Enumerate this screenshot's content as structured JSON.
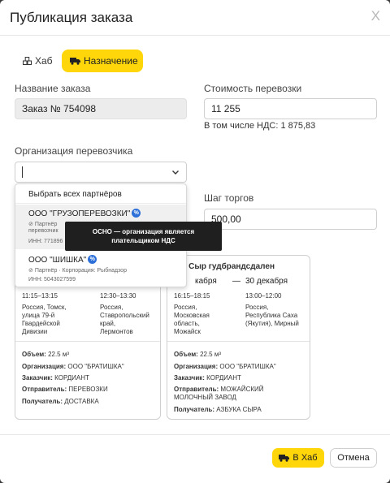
{
  "header": {
    "title": "Публикация заказа",
    "close": "X"
  },
  "tabs": [
    {
      "label": "Хаб",
      "icon": "cubes-icon"
    },
    {
      "label": "Назначение",
      "icon": "truck-icon",
      "active": true
    }
  ],
  "form": {
    "order_name_label": "Название заказа",
    "order_name_value": "Заказ № 754098",
    "cost_label": "Стоимость перевозки",
    "cost_value": "11 255",
    "vat_hint": "В том числе НДС: 1 875,83",
    "carrier_label": "Организация перевозчика",
    "bid_step_label": "Шаг торгов",
    "bid_step_value": "500,00"
  },
  "dropdown": {
    "select_all": "Выбрать всех партнёров",
    "options": [
      {
        "name": "ООО \"ГРУЗОПЕРЕВОЗКИ\"",
        "sub1": "Партнёр",
        "sub2": "перевозчик",
        "inn": "ИНН: 771896"
      },
      {
        "name": "ООО \"ШИШКА\"",
        "sub1": "Партнёр · Корпорация: Рыбнадзор",
        "inn": "ИНН: 5043027599"
      }
    ],
    "badge": "%"
  },
  "tooltip": {
    "line1": "ОСНО — организация является",
    "line2": "плательщиком НДС"
  },
  "cards": [
    {
      "from_time": "11:15–13:15",
      "to_time": "12:30–13:30",
      "from_place": [
        "Россия, Томск,",
        "улица 79-й",
        "Гвардейской",
        "Дивизии"
      ],
      "to_place": [
        "Россия,",
        "Ставропольский",
        "край,",
        "Лермонтов"
      ],
      "volume_label": "Объем:",
      "volume": "22.5 м³",
      "org_label": "Организация:",
      "org": "ООО \"БРАТИШКА\"",
      "customer_label": "Заказчик:",
      "customer": "КОРДИАНТ",
      "sender_label": "Отправитель:",
      "sender": "ПЕРЕВОЗКИ",
      "receiver_label": "Получатель:",
      "receiver": "ДОСТАВКА"
    },
    {
      "title": "] Сыр гудбрандсдален",
      "from_date": "кабря",
      "dash": "—",
      "to_date": "30 декабря",
      "from_time": "16:15–18:15",
      "to_time": "13:00–12:00",
      "from_place": [
        "Россия,",
        "Московская",
        "область,",
        "Можайск"
      ],
      "to_place": [
        "Россия,",
        "Республика Саха",
        "(Якутия), Мирный"
      ],
      "volume_label": "Объем:",
      "volume": "22.5 м³",
      "org_label": "Организация:",
      "org": "ООО \"БРАТИШКА\"",
      "customer_label": "Заказчик:",
      "customer": "КОРДИАНТ",
      "sender_label": "Отправитель:",
      "sender": "МОЖАЙСКИЙ",
      "sender2": "МОЛОЧНЫЙ ЗАВОД",
      "receiver_label": "Получатель:",
      "receiver": "АЗБУКА СЫРА"
    }
  ],
  "footer": {
    "to_hub": "В Хаб",
    "cancel": "Отмена"
  },
  "colors": {
    "accent": "#ffd60a",
    "badge": "#2d6fd8",
    "tooltip_bg": "#1f1f1f"
  }
}
